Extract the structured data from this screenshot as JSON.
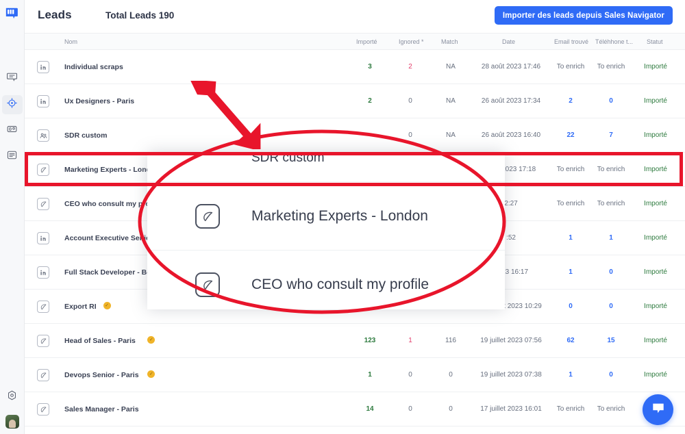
{
  "sidebar": {
    "logo_name": "waalaxy-logo",
    "items": [
      {
        "name": "messages",
        "icon": "speech-bubble-icon",
        "active": false
      },
      {
        "name": "campaigns",
        "icon": "target-crosshair-icon",
        "active": true
      },
      {
        "name": "stats",
        "icon": "counter-icon",
        "active": false
      },
      {
        "name": "leads",
        "icon": "list-document-icon",
        "active": false
      }
    ],
    "bottom_items": [
      {
        "name": "settings",
        "icon": "gear-icon"
      },
      {
        "name": "user-avatar",
        "icon": "avatar"
      }
    ]
  },
  "header": {
    "title": "Leads",
    "total_label": "Total Leads 190",
    "import_button": "Importer des leads depuis Sales Navigator"
  },
  "table": {
    "columns": [
      "Nom",
      "Importé",
      "Ignored *",
      "Match",
      "Date",
      "Email trouvé",
      "Téléhhone t...",
      "Statut"
    ],
    "rows": [
      {
        "icon": "linkedin-icon",
        "name": "Individual scraps",
        "verified": false,
        "imported": "3",
        "ignored": "2",
        "ignored_warn": true,
        "match": "NA",
        "date": "28 août 2023 17:46",
        "email": "To enrich",
        "email_link": false,
        "phone": "To enrich",
        "phone_link": false,
        "status": "Importé"
      },
      {
        "icon": "linkedin-icon",
        "name": "Ux Designers - Paris",
        "verified": false,
        "imported": "2",
        "ignored": "0",
        "ignored_warn": false,
        "match": "NA",
        "date": "26 août 2023 17:34",
        "email": "2",
        "email_link": true,
        "phone": "0",
        "phone_link": true,
        "status": "Importé"
      },
      {
        "icon": "group-icon",
        "name": "SDR custom",
        "verified": false,
        "imported": "",
        "ignored": "0",
        "ignored_warn": false,
        "match": "NA",
        "date": "26 août 2023 16:40",
        "email": "22",
        "email_link": true,
        "phone": "7",
        "phone_link": true,
        "status": "Importé"
      },
      {
        "icon": "leaf-icon",
        "name": "Marketing Experts - London",
        "verified": false,
        "imported": "",
        "ignored": "",
        "ignored_warn": false,
        "match": "",
        "date": "août 2023 17:18",
        "email": "To enrich",
        "email_link": false,
        "phone": "To enrich",
        "phone_link": false,
        "status": "Importé"
      },
      {
        "icon": "leaf-icon",
        "name": "CEO who consult my profile",
        "verified": false,
        "imported": "",
        "ignored": "",
        "ignored_warn": false,
        "match": "",
        "date": "2:27",
        "email": "To enrich",
        "email_link": false,
        "phone": "To enrich",
        "phone_link": false,
        "status": "Importé"
      },
      {
        "icon": "linkedin-icon",
        "name": "Account Executive Senior",
        "verified": false,
        "imported": "",
        "ignored": "",
        "ignored_warn": false,
        "match": "",
        "date": ":52",
        "email": "1",
        "email_link": true,
        "phone": "1",
        "phone_link": true,
        "status": "Importé"
      },
      {
        "icon": "linkedin-icon",
        "name": "Full Stack Developer - Berlin",
        "verified": true,
        "imported": "",
        "ignored": "",
        "ignored_warn": false,
        "match": "",
        "date": "2023 16:17",
        "email": "1",
        "email_link": true,
        "phone": "0",
        "phone_link": true,
        "status": "Importé"
      },
      {
        "icon": "leaf-icon",
        "name": "Export RI",
        "verified": true,
        "imported": "",
        "ignored": "",
        "ignored_warn": false,
        "match": "",
        "date": "21 juillet 2023 10:29",
        "email": "0",
        "email_link": true,
        "phone": "0",
        "phone_link": true,
        "status": "Importé"
      },
      {
        "icon": "leaf-icon",
        "name": "Head of Sales - Paris",
        "verified": true,
        "imported": "123",
        "ignored": "1",
        "ignored_warn": true,
        "match": "116",
        "date": "19 juillet 2023 07:56",
        "email": "62",
        "email_link": true,
        "phone": "15",
        "phone_link": true,
        "status": "Importé"
      },
      {
        "icon": "leaf-icon",
        "name": "Devops Senior - Paris",
        "verified": true,
        "imported": "1",
        "ignored": "0",
        "ignored_warn": false,
        "match": "0",
        "date": "19 juillet 2023 07:38",
        "email": "1",
        "email_link": true,
        "phone": "0",
        "phone_link": true,
        "status": "Importé"
      },
      {
        "icon": "leaf-icon",
        "name": "Sales Manager - Paris",
        "verified": false,
        "imported": "14",
        "ignored": "0",
        "ignored_warn": false,
        "match": "0",
        "date": "17 juillet 2023 16:01",
        "email": "To enrich",
        "email_link": false,
        "phone": "To enrich",
        "phone_link": false,
        "status": "Importé"
      }
    ]
  },
  "magnifier": {
    "rows": [
      {
        "icon": "leaf-icon",
        "name": "SDR custom"
      },
      {
        "icon": "leaf-icon",
        "name": "Marketing Experts - London"
      },
      {
        "icon": "leaf-icon",
        "name": "CEO who consult my profile"
      }
    ]
  },
  "chat": {
    "icon": "chat-bubble-icon"
  },
  "colors": {
    "accent": "#2f6bf6",
    "annotation": "#e8152b",
    "success": "#2d7a3e",
    "warning": "#e23c6a",
    "verified_badge": "#f0b429"
  }
}
